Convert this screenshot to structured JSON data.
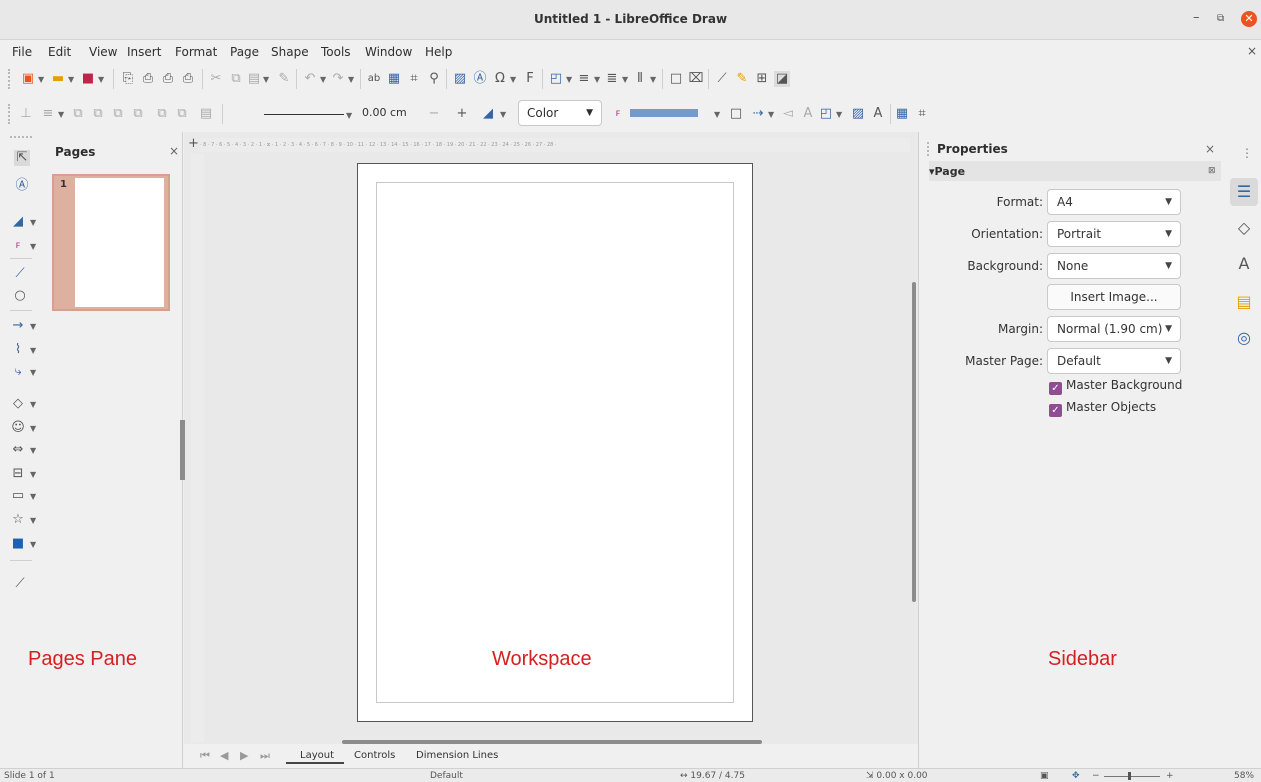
{
  "window": {
    "title": "Untitled 1 - LibreOffice Draw"
  },
  "menu": [
    "File",
    "Edit",
    "View",
    "Insert",
    "Format",
    "Page",
    "Shape",
    "Tools",
    "Window",
    "Help"
  ],
  "toolbar2": {
    "line_width": "0.00 cm",
    "area_style": "Color"
  },
  "pages_pane": {
    "title": "Pages",
    "thumbnail_number": "1"
  },
  "tabs": [
    "Layout",
    "Controls",
    "Dimension Lines"
  ],
  "sidebar": {
    "title": "Properties",
    "section": "Page",
    "format_label": "Format:",
    "format_value": "A4",
    "orientation_label": "Orientation:",
    "orientation_value": "Portrait",
    "background_label": "Background:",
    "background_value": "None",
    "insert_image": "Insert Image...",
    "margin_label": "Margin:",
    "margin_value": "Normal (1.90 cm)",
    "master_page_label": "Master Page:",
    "master_page_value": "Default",
    "master_background": "Master Background",
    "master_objects": "Master Objects"
  },
  "annotations": {
    "pages_pane": "Pages Pane",
    "workspace": "Workspace",
    "sidebar": "Sidebar"
  },
  "status": {
    "slide": "Slide 1 of 1",
    "master": "Default",
    "position": "19.67 / 4.75",
    "size": "0.00 x 0.00",
    "zoom": "58%"
  },
  "colors": {
    "accent": "#e95420",
    "checkbox": "#8f4e8f",
    "label_red": "#d62020",
    "fill_bar": "#7799cc"
  },
  "icons": [
    "new-icon",
    "open-icon",
    "save-icon",
    "export-icon",
    "pdf-icon",
    "print-icon",
    "cut-icon",
    "copy-icon",
    "paste-icon",
    "undo-icon",
    "redo-icon",
    "spelling-icon",
    "grid-icon",
    "zoom-icon",
    "image-icon",
    "textbox-icon",
    "special-character-icon",
    "select-icon",
    "line-icon",
    "ellipse-icon",
    "basic-shapes-icon",
    "symbol-shapes-icon",
    "block-arrows-icon",
    "flowchart-icon",
    "callouts-icon",
    "stars-icon",
    "3d-objects-icon",
    "properties-icon",
    "styles-icon",
    "gallery-icon",
    "navigator-icon"
  ]
}
